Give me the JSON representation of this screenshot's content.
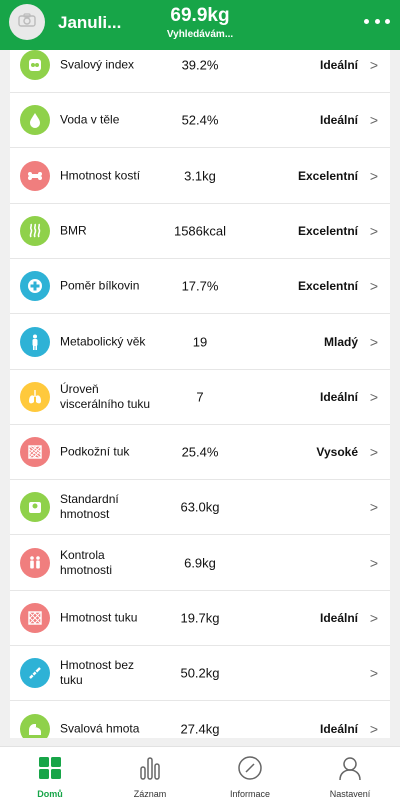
{
  "header": {
    "user_name": "Januli...",
    "weight": "69.9kg",
    "status": "Vyhledávám..."
  },
  "metrics": [
    {
      "label": "Svalový index",
      "value": "39.2%",
      "status": "Ideální",
      "icon": "muscle-icon",
      "color": "#8fd14a"
    },
    {
      "label": "Voda v těle",
      "value": "52.4%",
      "status": "Ideální",
      "icon": "water-drop-icon",
      "color": "#8fd14a"
    },
    {
      "label": "Hmotnost kostí",
      "value": "3.1kg",
      "status": "Excelentní",
      "icon": "bone-icon",
      "color": "#f07e7e"
    },
    {
      "label": "BMR",
      "value": "1586kcal",
      "status": "Excelentní",
      "icon": "heat-waves-icon",
      "color": "#8fd14a"
    },
    {
      "label": "Poměr bílkovin",
      "value": "17.7%",
      "status": "Excelentní",
      "icon": "protein-cross-icon",
      "color": "#2eb2d6"
    },
    {
      "label": "Metabolický věk",
      "value": "19",
      "status": "Mladý",
      "icon": "person-icon",
      "color": "#2eb2d6"
    },
    {
      "label": "Úroveň viscerálního tuku",
      "value": "7",
      "status": "Ideální",
      "icon": "lungs-icon",
      "color": "#ffc93c"
    },
    {
      "label": "Podkožní tuk",
      "value": "25.4%",
      "status": "Vysoké",
      "icon": "fat-mesh-icon",
      "color": "#f07e7e"
    },
    {
      "label": "Standardní hmotnost",
      "value": "63.0kg",
      "status": "",
      "icon": "scale-icon",
      "color": "#8fd14a"
    },
    {
      "label": "Kontrola hmotnosti",
      "value": "6.9kg",
      "status": "",
      "icon": "weight-control-icon",
      "color": "#f07e7e"
    },
    {
      "label": "Hmotnost tuku",
      "value": "19.7kg",
      "status": "Ideální",
      "icon": "fat-mass-icon",
      "color": "#f07e7e"
    },
    {
      "label": "Hmotnost bez tuku",
      "value": "50.2kg",
      "status": "",
      "icon": "lean-mass-icon",
      "color": "#2eb2d6"
    },
    {
      "label": "Svalová hmota",
      "value": "27.4kg",
      "status": "Ideální",
      "icon": "muscle-arm-icon",
      "color": "#8fd14a"
    }
  ],
  "tabs": [
    {
      "label": "Domů",
      "icon": "home-grid-icon",
      "active": true
    },
    {
      "label": "Záznam",
      "icon": "bar-chart-icon",
      "active": false
    },
    {
      "label": "Informace",
      "icon": "compass-icon",
      "active": false
    },
    {
      "label": "Nastavení",
      "icon": "user-icon",
      "active": false
    }
  ],
  "colors": {
    "brand": "#17a548",
    "divider": "#e6e6e6"
  }
}
